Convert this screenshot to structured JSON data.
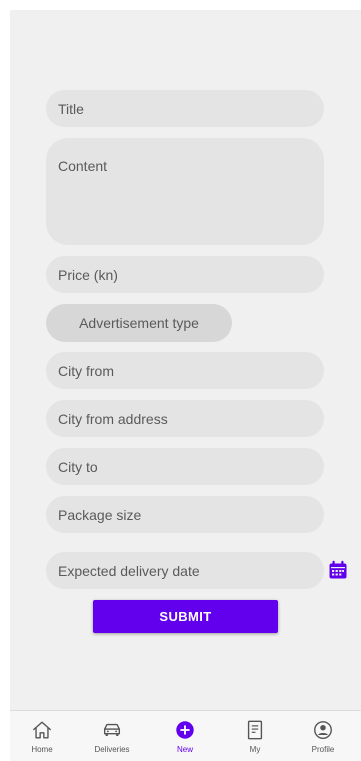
{
  "form": {
    "title_placeholder": "Title",
    "content_placeholder": "Content",
    "price_placeholder": "Price (kn)",
    "ad_type_label": "Advertisement type",
    "city_from_placeholder": "City from",
    "city_from_address_placeholder": "City from address",
    "city_to_placeholder": "City to",
    "package_size_placeholder": "Package size",
    "expected_date_placeholder": "Expected delivery date",
    "submit_label": "SUBMIT"
  },
  "nav": {
    "items": [
      {
        "label": "Home",
        "icon": "home-icon"
      },
      {
        "label": "Deliveries",
        "icon": "car-icon"
      },
      {
        "label": "New",
        "icon": "add-circle-icon",
        "active": true
      },
      {
        "label": "My",
        "icon": "document-icon"
      },
      {
        "label": "Profile",
        "icon": "profile-icon"
      }
    ]
  },
  "colors": {
    "accent": "#6200ee",
    "field_bg": "#e4e4e4",
    "screen_bg": "#f0f0f0"
  }
}
